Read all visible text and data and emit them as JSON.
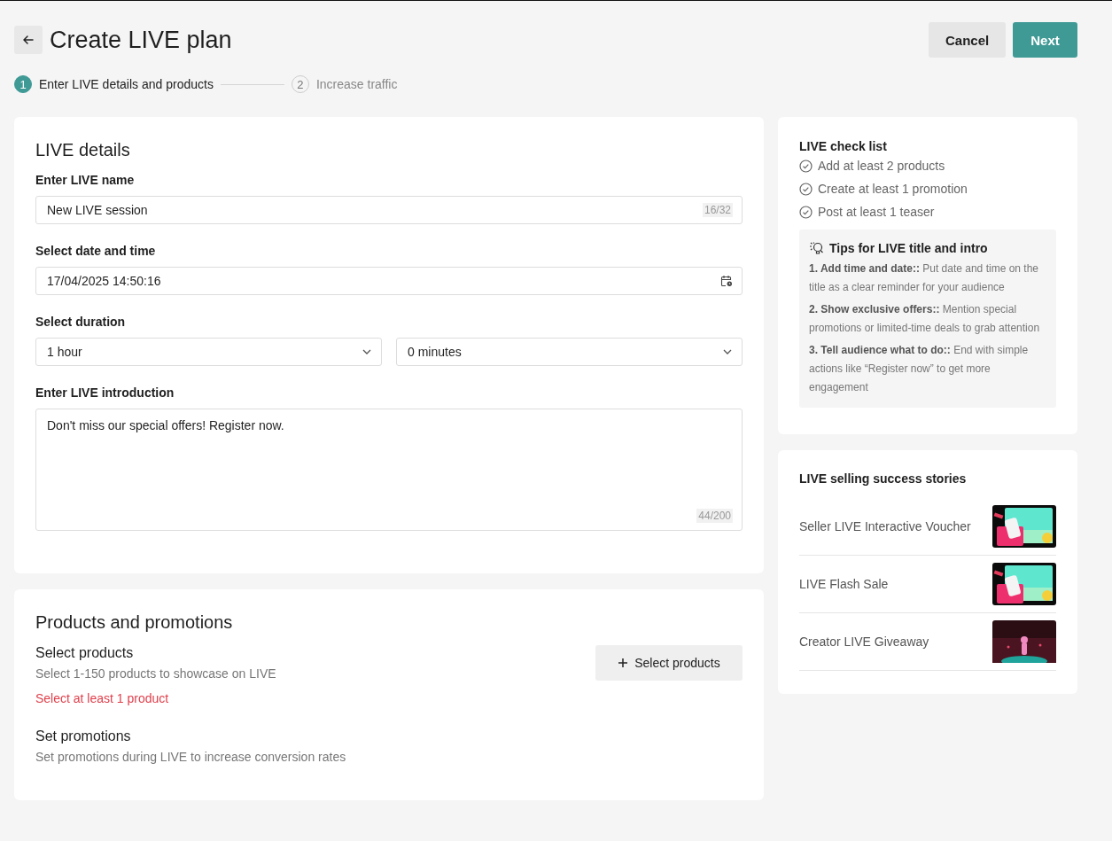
{
  "header": {
    "title": "Create LIVE plan",
    "buttons": [
      {
        "label": "Cancel",
        "kind": "secondary"
      },
      {
        "label": "Next",
        "kind": "primary"
      }
    ]
  },
  "steps": [
    {
      "number": "1",
      "label": "Enter LIVE details and products",
      "selected": true
    },
    {
      "number": "2",
      "label": "Increase traffic",
      "selected": false
    }
  ],
  "live_details": {
    "title": "LIVE details",
    "name": {
      "label": "Enter LIVE name",
      "value": "New LIVE session",
      "counter": "16/32"
    },
    "datetime": {
      "label": "Select date and time",
      "value": "17/04/2025 14:50:16"
    },
    "duration": {
      "label": "Select duration",
      "hours": "1 hour",
      "minutes": "0 minutes"
    },
    "intro": {
      "label": "Enter LIVE introduction",
      "value": "Don't miss our special offers! Register now.",
      "counter": "44/200"
    }
  },
  "products_promotions": {
    "title": "Products and promotions",
    "select_products": {
      "title": "Select products",
      "description": "Select 1-150 products to showcase on LIVE",
      "error": "Select at least 1 product",
      "button": "Select products"
    },
    "set_promotions": {
      "title": "Set promotions",
      "description": "Set promotions during LIVE to increase conversion rates"
    }
  },
  "check_list": {
    "title": "LIVE check list",
    "items": [
      "Add at least 2 products",
      "Create at least 1 promotion",
      "Post at least 1 teaser"
    ]
  },
  "tips": {
    "title": "Tips for LIVE title and intro",
    "items": [
      "**1. Add time and date::** Put date and time on the title as a clear reminder for your audience",
      "**2. Show exclusive offers::** Mention special promotions or limited-time deals to grab attention",
      "**3. Tell audience what to do::** End with simple actions like “Register now” to get more engagement"
    ]
  },
  "success_stories": {
    "title": "LIVE selling success stories",
    "items": [
      {
        "title": "Seller LIVE Interactive Voucher",
        "kind": "picture"
      },
      {
        "title": "LIVE Flash Sale",
        "kind": "picture"
      },
      {
        "title": "Creator LIVE Giveaway",
        "kind": "picture"
      }
    ]
  }
}
